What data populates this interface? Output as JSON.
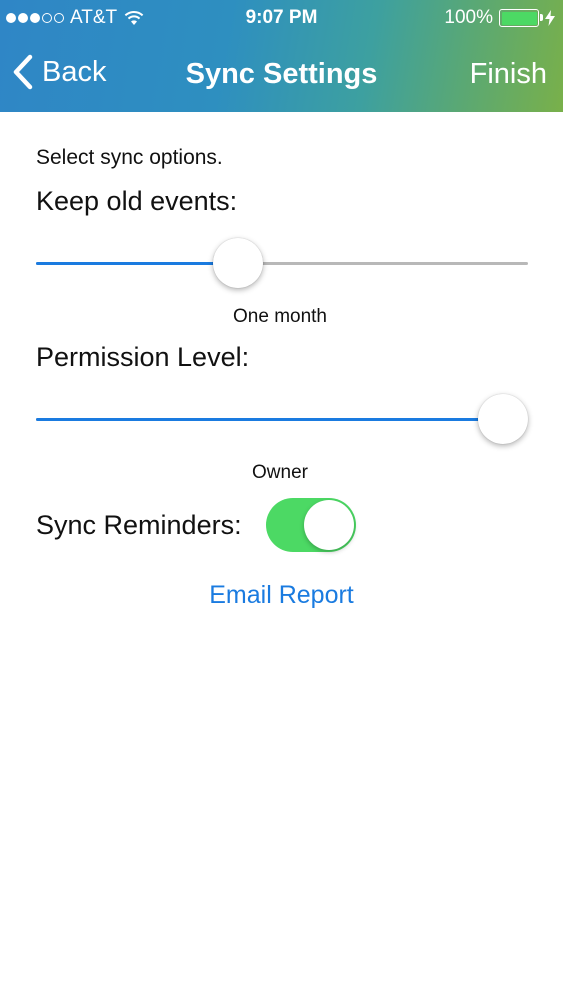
{
  "status_bar": {
    "carrier": "AT&T",
    "time": "9:07 PM",
    "battery": "100%",
    "signal_filled": 3,
    "signal_total": 5,
    "battery_color": "#4cd964",
    "icons": [
      "wifi-icon",
      "battery-icon",
      "charging-bolt-icon"
    ]
  },
  "nav": {
    "back_label": "Back",
    "title": "Sync Settings",
    "finish_label": "Finish",
    "gradient": [
      "#2f86c6",
      "#79b04a"
    ]
  },
  "content": {
    "intro": "Select sync options.",
    "keep_old_events": {
      "label": "Keep old events:",
      "value_label": "One month",
      "slider_fraction": 0.41
    },
    "permission_level": {
      "label": "Permission Level:",
      "value_label": "Owner",
      "slider_fraction": 1.0
    },
    "sync_reminders": {
      "label": "Sync Reminders:",
      "enabled": true
    },
    "email_report_label": "Email Report"
  },
  "colors": {
    "accent": "#1a7be0",
    "toggle_on": "#4cd964",
    "track_off": "#b8b8b8"
  }
}
